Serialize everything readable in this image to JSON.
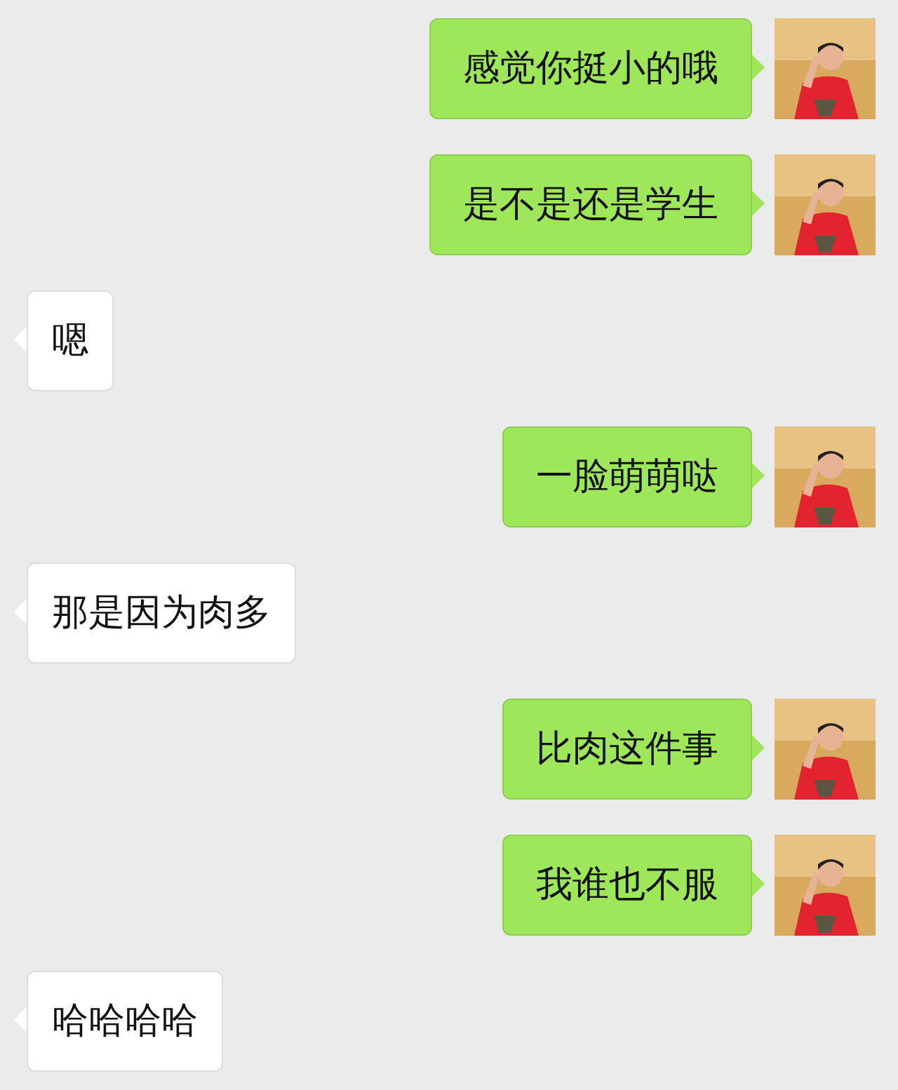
{
  "messages": [
    {
      "kind": "sent",
      "text": "感觉你挺小的哦"
    },
    {
      "kind": "sent",
      "text": "是不是还是学生"
    },
    {
      "kind": "received",
      "text": "嗯"
    },
    {
      "kind": "sent",
      "text": "一脸萌萌哒"
    },
    {
      "kind": "received",
      "text": "那是因为肉多"
    },
    {
      "kind": "sent",
      "text": "比肉这件事"
    },
    {
      "kind": "sent",
      "text": "我谁也不服"
    },
    {
      "kind": "received",
      "text": "哈哈哈哈"
    }
  ]
}
